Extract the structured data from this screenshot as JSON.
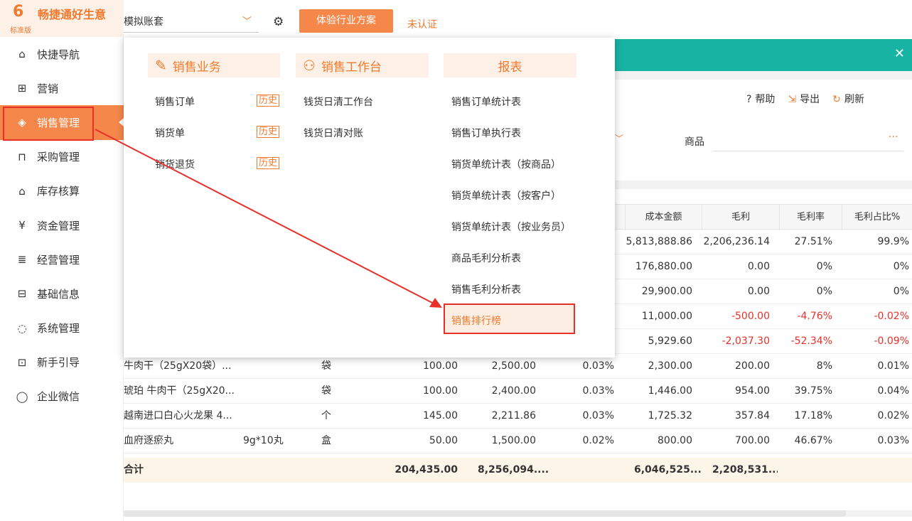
{
  "logo": {
    "mark": "6",
    "brand": "畅捷通好生意",
    "edition": "标准版"
  },
  "sidebar": {
    "items": [
      {
        "label": "快捷导航",
        "icon": "home-icon",
        "glyph": "⌂"
      },
      {
        "label": "营销",
        "icon": "gift-icon",
        "glyph": "⊞"
      },
      {
        "label": "销售管理",
        "icon": "sales-icon",
        "glyph": "◈",
        "active": true
      },
      {
        "label": "采购管理",
        "icon": "bag-icon",
        "glyph": "⊓"
      },
      {
        "label": "库存核算",
        "icon": "warehouse-icon",
        "glyph": "⌂"
      },
      {
        "label": "资金管理",
        "icon": "money-icon",
        "glyph": "¥"
      },
      {
        "label": "经营管理",
        "icon": "clipboard-icon",
        "glyph": "≣"
      },
      {
        "label": "基础信息",
        "icon": "id-card-icon",
        "glyph": "⊟"
      },
      {
        "label": "系统管理",
        "icon": "system-icon",
        "glyph": "◌"
      },
      {
        "label": "新手引导",
        "icon": "new-icon",
        "glyph": "⊡"
      },
      {
        "label": "企业微信",
        "icon": "wechat-icon",
        "glyph": "◯"
      }
    ]
  },
  "topbar": {
    "account": "模拟账套",
    "trial_button": "体验行业方案",
    "unverified": "未认证"
  },
  "toolbar": {
    "help": "帮助",
    "export": "导出",
    "refresh": "刷新"
  },
  "filter": {
    "product_label": "商品",
    "more": "···"
  },
  "menu": {
    "sales_business": {
      "title": "销售业务",
      "items": [
        "销售订单",
        "销货单",
        "销货退货"
      ],
      "history": "历史"
    },
    "sales_workbench": {
      "title": "销售工作台",
      "items": [
        "钱货日清工作台",
        "钱货日清对账"
      ]
    },
    "reports": {
      "title": "报表",
      "items": [
        "销售订单统计表",
        "销售订单执行表",
        "销货单统计表（按商品）",
        "销货单统计表（按客户）",
        "销货单统计表（按业务员）",
        "商品毛利分析表",
        "销售毛利分析表",
        "销售排行榜"
      ]
    }
  },
  "table": {
    "headers": [
      "成本金额",
      "毛利",
      "毛利率",
      "毛利占比%"
    ],
    "rows": [
      {
        "name": "",
        "spec": "",
        "unit": "",
        "qty": "",
        "amount": "",
        "pct": "",
        "cost": "5,813,888.86",
        "profit": "2,206,236.14",
        "rate": "27.51%",
        "share": "99.9%",
        "neg": false
      },
      {
        "name": "",
        "spec": "",
        "unit": "",
        "qty": "",
        "amount": "",
        "pct": "",
        "cost": "176,880.00",
        "profit": "0.00",
        "rate": "0%",
        "share": "0%",
        "neg": false
      },
      {
        "name": "",
        "spec": "",
        "unit": "",
        "qty": "",
        "amount": "",
        "pct": "",
        "cost": "29,900.00",
        "profit": "0.00",
        "rate": "0%",
        "share": "0%",
        "neg": false
      },
      {
        "name": "",
        "spec": "",
        "unit": "",
        "qty": "",
        "amount": "",
        "pct": "",
        "cost": "11,000.00",
        "profit": "-500.00",
        "rate": "-4.76%",
        "share": "-0.02%",
        "neg": true
      },
      {
        "name": "",
        "spec": "",
        "unit": "",
        "qty": "",
        "amount": "",
        "pct": "",
        "cost": "5,929.60",
        "profit": "-2,037.30",
        "rate": "-52.34%",
        "share": "-0.09%",
        "neg": true
      },
      {
        "name": "牛肉干（25gX20袋）...",
        "spec": "",
        "unit": "袋",
        "qty": "100.00",
        "amount": "2,500.00",
        "pct": "0.03%",
        "cost": "2,300.00",
        "profit": "200.00",
        "rate": "8%",
        "share": "0.01%",
        "neg": false
      },
      {
        "name": "琥珀 牛肉干（25gX20...",
        "spec": "",
        "unit": "袋",
        "qty": "100.00",
        "amount": "2,400.00",
        "pct": "0.03%",
        "cost": "1,446.00",
        "profit": "954.00",
        "rate": "39.75%",
        "share": "0.04%",
        "neg": false
      },
      {
        "name": "越南进口白心火龙果 4...",
        "spec": "",
        "unit": "个",
        "qty": "145.00",
        "amount": "2,211.86",
        "pct": "0.03%",
        "cost": "1,725.32",
        "profit": "357.84",
        "rate": "17.18%",
        "share": "0.02%",
        "neg": false
      },
      {
        "name": "血府逐瘀丸",
        "spec": "9g*10丸",
        "unit": "盒",
        "qty": "50.00",
        "amount": "1,500.00",
        "pct": "0.02%",
        "cost": "800.00",
        "profit": "700.00",
        "rate": "46.67%",
        "share": "0.03%",
        "neg": false
      }
    ],
    "total": {
      "label": "合计",
      "qty": "204,435.00",
      "amount": "8,256,094....",
      "cost": "6,046,525....",
      "profit": "2,208,531...."
    }
  }
}
